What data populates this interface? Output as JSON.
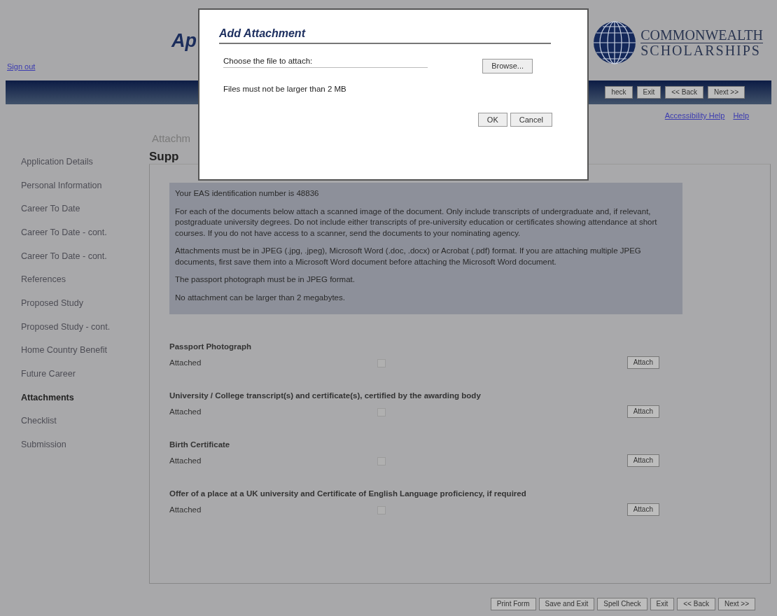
{
  "header": {
    "sign_out": "Sign out",
    "title": "Ap",
    "logo": {
      "line_1": "COMMONWEALTH",
      "line_2": "SCHOLARSHIPS"
    }
  },
  "toolbar": {
    "buttons": [
      "heck",
      "Exit",
      "<< Back",
      "Next >>"
    ]
  },
  "help_links": [
    "Accessibility Help",
    "Help"
  ],
  "breadcrumb": "Attachm",
  "sidebar": {
    "items": [
      {
        "label": "Application Details",
        "selected": false
      },
      {
        "label": "Personal Information",
        "selected": false
      },
      {
        "label": "Career To Date",
        "selected": false
      },
      {
        "label": "Career To Date - cont.",
        "selected": false
      },
      {
        "label": "Career To Date - cont.",
        "selected": false
      },
      {
        "label": "References",
        "selected": false
      },
      {
        "label": "Proposed Study",
        "selected": false
      },
      {
        "label": "Proposed Study - cont.",
        "selected": false
      },
      {
        "label": "Home Country Benefit",
        "selected": false
      },
      {
        "label": "Future Career",
        "selected": false
      },
      {
        "label": "Attachments",
        "selected": true
      },
      {
        "label": "Checklist",
        "selected": false
      },
      {
        "label": "Submission",
        "selected": false
      }
    ]
  },
  "panel": {
    "heading": "Supp",
    "info": [
      "Your EAS identification number is 48836",
      "For each of the documents below attach a scanned image of the document. Only include transcripts of undergraduate and, if relevant, postgraduate university degrees. Do not include either transcripts of pre-university education or certificates showing attendance at short courses. If you do not have access to a scanner, send the documents to your nominating agency.",
      "Attachments must be in JPEG (.jpg, .jpeg), Microsoft Word (.doc, .docx) or Acrobat (.pdf) format. If you are attaching multiple JPEG documents, first save them into a Microsoft Word document before attaching the Microsoft Word document.",
      "The passport photograph must be in JPEG format.",
      "No attachment can be larger than 2 megabytes."
    ],
    "documents": [
      {
        "title": "Passport Photograph",
        "status": "Attached",
        "checked": false,
        "button": "Attach"
      },
      {
        "title": "University / College transcript(s) and certificate(s), certified by the awarding body",
        "status": "Attached",
        "checked": false,
        "button": "Attach"
      },
      {
        "title": "Birth Certificate",
        "status": "Attached",
        "checked": false,
        "button": "Attach"
      },
      {
        "title": "Offer of a place at a UK university and Certificate of English Language proficiency, if required",
        "status": "Attached",
        "checked": false,
        "button": "Attach"
      }
    ]
  },
  "footer_buttons": [
    "Print Form",
    "Save and Exit",
    "Spell Check",
    "Exit",
    "<< Back",
    "Next >>"
  ],
  "dialog": {
    "title": "Add Attachment",
    "label": "Choose the file to attach:",
    "browse": "Browse...",
    "note": "Files must not be larger than 2 MB",
    "buttons": [
      "OK",
      "Cancel"
    ]
  }
}
